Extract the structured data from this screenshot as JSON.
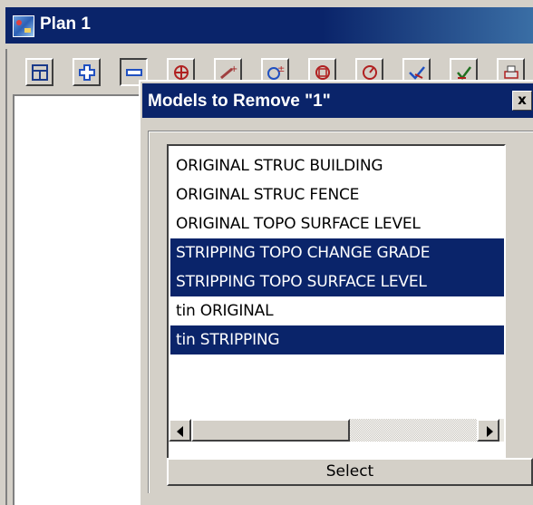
{
  "plan_window": {
    "title": "Plan 1",
    "icon": "plan-window-icon"
  },
  "toolbar": {
    "buttons": [
      {
        "icon": "plot-icon"
      },
      {
        "icon": "add-models-icon"
      },
      {
        "icon": "remove-models-icon",
        "pressed": true
      },
      {
        "icon": "zoom-extent-icon"
      },
      {
        "icon": "pan-icon"
      },
      {
        "icon": "zoom-in-icon"
      },
      {
        "icon": "zoom-window-icon"
      },
      {
        "icon": "rotate-icon"
      },
      {
        "icon": "select-icon"
      },
      {
        "icon": "edit-icon"
      },
      {
        "icon": "print-icon"
      }
    ]
  },
  "dialog": {
    "title": "Models to Remove \"1\"",
    "close_label": "x",
    "models": [
      {
        "label": "ORIGINAL STRUC BUILDING",
        "selected": false
      },
      {
        "label": "ORIGINAL STRUC FENCE",
        "selected": false
      },
      {
        "label": "ORIGINAL TOPO SURFACE LEVEL",
        "selected": false
      },
      {
        "label": "STRIPPING TOPO CHANGE GRADE",
        "selected": true
      },
      {
        "label": "STRIPPING TOPO SURFACE LEVEL",
        "selected": true
      },
      {
        "label": "tin ORIGINAL",
        "selected": false
      },
      {
        "label": "tin STRIPPING",
        "selected": true
      }
    ],
    "select_label": "Select"
  },
  "colors": {
    "selection": "#0a246a",
    "dialog_bg": "#d4d0c8",
    "title_bar": "#0a246a"
  }
}
